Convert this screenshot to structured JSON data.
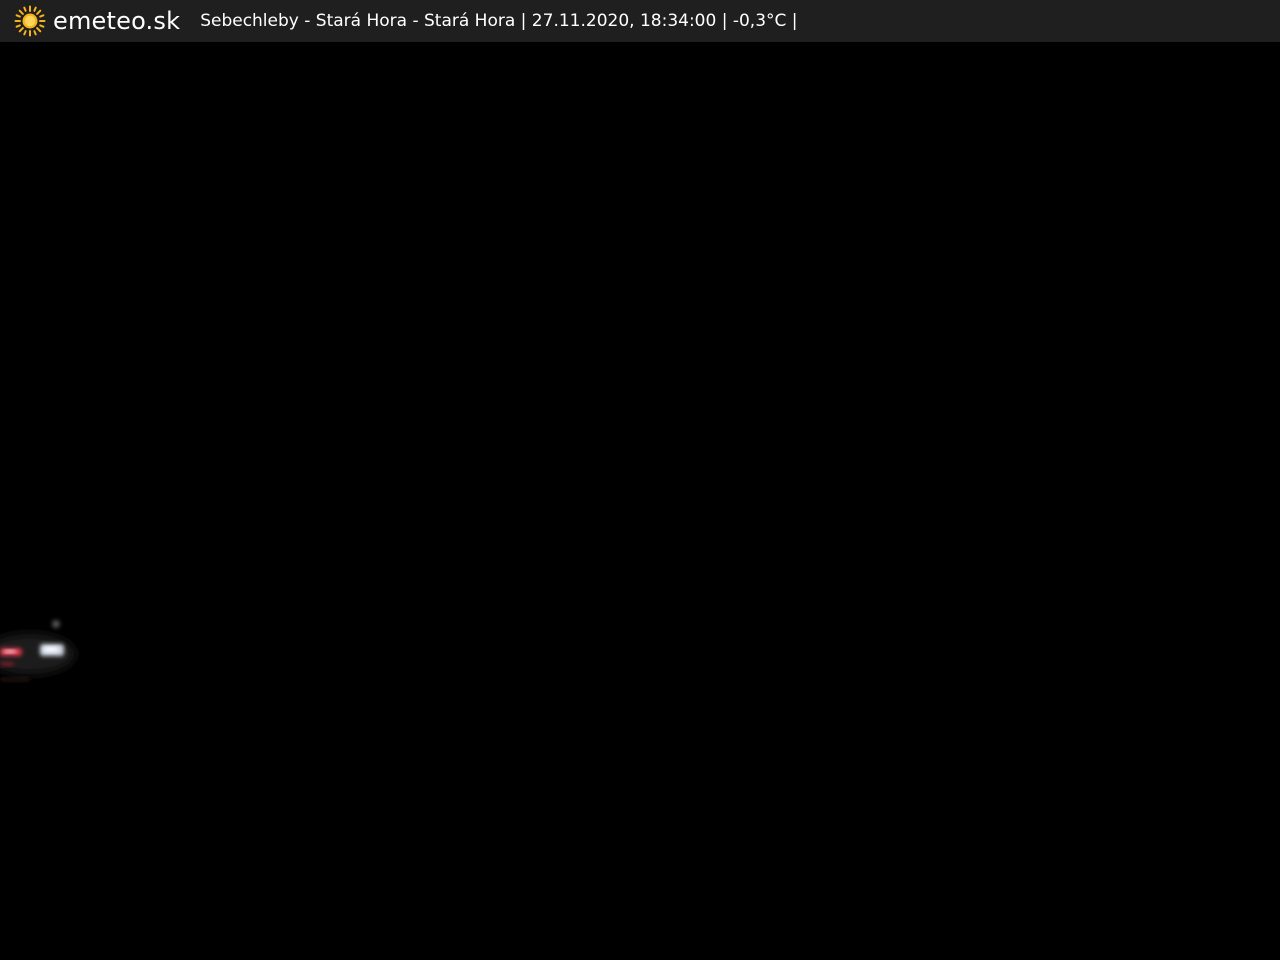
{
  "header": {
    "brand": "emeteo.sk",
    "caption": "Sebechleby - Stará Hora - Stará Hora | 27.11.2020, 18:34:00 | -0,3°C |",
    "logo_icon": "sun-icon",
    "bar_color": "#1f1f1f",
    "sun_color": "#f6b21b"
  },
  "camera": {
    "scene": "night",
    "background_color": "#000000"
  }
}
